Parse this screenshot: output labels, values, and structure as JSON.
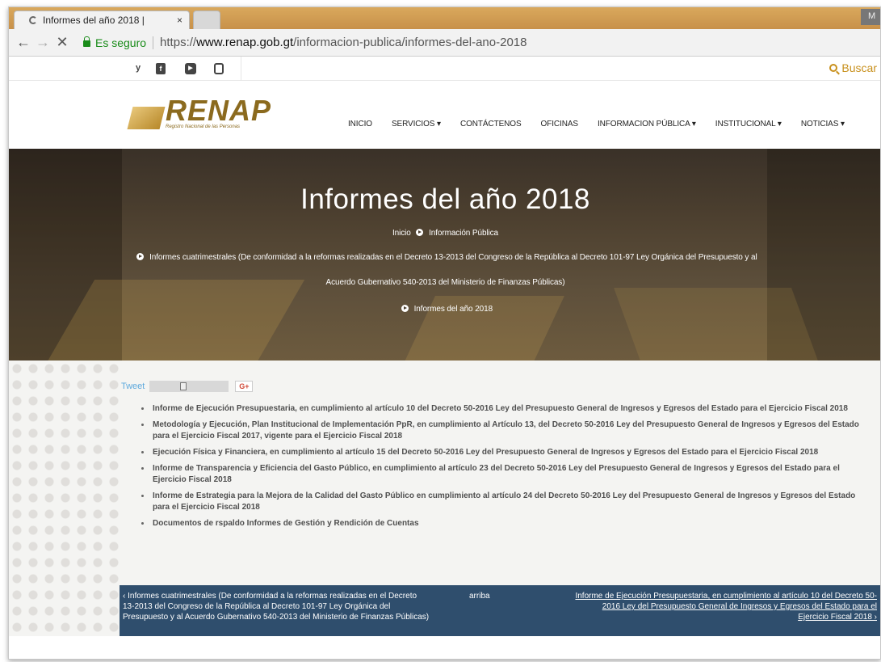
{
  "browser": {
    "tab_title": "Informes del año 2018 | ",
    "tab_close": "×",
    "window_label": "M",
    "secure_label": "Es seguro",
    "url_scheme": "https://",
    "url_domain": "www.renap.gob.gt",
    "url_path": "/informacion-publica/informes-del-ano-2018",
    "back_glyph": "←",
    "forward_glyph": "→",
    "stop_glyph": "✕"
  },
  "site_top": {
    "social": [
      {
        "name": "twitter",
        "glyph": "y"
      },
      {
        "name": "facebook",
        "glyph": "f"
      },
      {
        "name": "youtube",
        "glyph": "▶"
      },
      {
        "name": "instagram",
        "glyph": ""
      }
    ],
    "search_label": "Buscar"
  },
  "brand": {
    "name": "RENAP",
    "subtitle": "Registro Nacional de las Personas",
    "gold": "#b8892a"
  },
  "menu": [
    "INICIO",
    "SERVICIOS ▾",
    "CONTÁCTENOS",
    "OFICINAS",
    "INFORMACION PÚBLICA ▾",
    "INSTITUCIONAL ▾",
    "NOTICIAS ▾"
  ],
  "hero": {
    "title": "Informes del año 2018",
    "crumb_home": "Inicio",
    "crumb_section": "Información Pública",
    "crumb_parent_1": "Informes cuatrimestrales (De conformidad a la reformas realizadas en el Decreto 13-2013 del Congreso de la República al Decreto 101-97 Ley Orgánica del Presupuesto y al",
    "crumb_parent_2": "Acuerdo Gubernativo 540-2013 del Ministerio de Finanzas Públicas)",
    "crumb_current": "Informes del año 2018"
  },
  "share": {
    "tweet": "Tweet",
    "gplus": "G+"
  },
  "documents": [
    "Informe de Ejecución Presupuestaria, en cumplimiento al artículo 10 del Decreto 50-2016 Ley del Presupuesto General de Ingresos y Egresos del Estado para el Ejercicio Fiscal 2018",
    "Metodología y Ejecución, Plan Institucional de Implementación PpR, en cumplimiento al Artículo 13, del Decreto 50-2016 Ley del Presupuesto General de Ingresos y Egresos del Estado para el Ejercicio Fiscal 2017, vigente para el Ejercicio Fiscal 2018",
    "Ejecución Física y Financiera, en cumplimiento al artículo 15 del Decreto 50-2016 Ley del Presupuesto General de Ingresos y Egresos del Estado para el Ejercicio Fiscal 2018",
    "Informe de Transparencia y Eficiencia del Gasto Público, en cumplimiento al artículo 23 del Decreto 50-2016 Ley del Presupuesto General de Ingresos y Egresos del Estado para el Ejercicio Fiscal 2018",
    "Informe de Estrategia para la Mejora de la Calidad del Gasto Público en cumplimiento al artículo 24 del Decreto 50-2016 Ley del Presupuesto General de Ingresos y Egresos del Estado para el Ejercicio Fiscal 2018",
    "Documentos de rspaldo Informes de Gestión y Rendición de Cuentas"
  ],
  "footer_nav": {
    "prev": "‹ Informes cuatrimestrales (De conformidad a la reformas realizadas en el Decreto 13-2013 del Congreso de la República al Decreto 101-97 Ley Orgánica del Presupuesto y al Acuerdo Gubernativo 540-2013 del Ministerio de Finanzas Públicas)",
    "up": "arriba",
    "next": "Informe de Ejecución Presupuestaria, en cumplimiento al artículo 10 del Decreto 50-2016 Ley del Presupuesto General de Ingresos y Egresos del Estado para el Ejercicio Fiscal 2018 ›"
  }
}
